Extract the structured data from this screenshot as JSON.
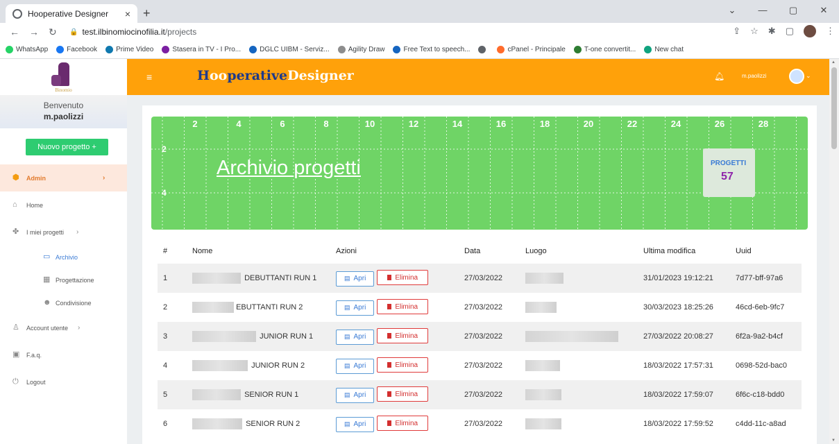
{
  "browser": {
    "tab_title": "Hooperative Designer",
    "tab_close": "×",
    "new_tab": "+",
    "url_domain": "test.ilbinomiocinofilia.it",
    "url_path": "/projects",
    "bookmarks": [
      {
        "label": "WhatsApp",
        "color": "#25d366"
      },
      {
        "label": "Facebook",
        "color": "#1877f2"
      },
      {
        "label": "Prime Video",
        "color": "#0f79af"
      },
      {
        "label": "Stasera in TV - I Pro...",
        "color": "#7b1fa2"
      },
      {
        "label": "DGLC UIBM - Serviz...",
        "color": "#1565c0"
      },
      {
        "label": "Agility Draw",
        "color": "#8d8d8d"
      },
      {
        "label": "Free Text to speech...",
        "color": "#1565c0"
      },
      {
        "label": "",
        "color": "#5f6368"
      },
      {
        "label": "cPanel - Principale",
        "color": "#ff6c2c"
      },
      {
        "label": "T-one convertit...",
        "color": "#2e7d32"
      },
      {
        "label": "New chat",
        "color": "#10a37f"
      }
    ]
  },
  "sidebar": {
    "welcome": "Benvenuto",
    "username": "m.paolizzi",
    "logo_text": "Binomio",
    "new_project": "Nuovo progetto +",
    "menu": {
      "admin": "Admin",
      "home": "Home",
      "my_projects": "I miei progetti",
      "archivio": "Archivio",
      "progettazione": "Progettazione",
      "condivisione": "Condivisione",
      "account": "Account utente",
      "faq": "F.a.q.",
      "logout": "Logout"
    }
  },
  "header": {
    "brand_h": "H",
    "brand_oo": "oo",
    "brand_rest": "perative",
    "brand_designer": "Designer",
    "user": "m.paolizzi"
  },
  "field": {
    "title": "Archivio progetti",
    "x_ticks": [
      "2",
      "4",
      "6",
      "8",
      "10",
      "12",
      "14",
      "16",
      "18",
      "20",
      "22",
      "24",
      "26",
      "28"
    ],
    "y_ticks": [
      "2",
      "4"
    ],
    "badge_label": "PROGETTI",
    "badge_value": "57"
  },
  "table": {
    "headers": [
      "#",
      "Nome",
      "Azioni",
      "Data",
      "Luogo",
      "Ultima modifica",
      "Uuid"
    ],
    "open_label": "Apri",
    "delete_label": "Elimina",
    "rows": [
      {
        "n": "1",
        "name": "DEBUTTANTI RUN 1",
        "date": "27/03/2022",
        "modified": "31/01/2023 19:12:21",
        "uuid": "7d77-bff-97a6"
      },
      {
        "n": "2",
        "name": "EBUTTANTI RUN 2",
        "date": "27/03/2022",
        "modified": "30/03/2023 18:25:26",
        "uuid": "46cd-6eb-9fc7"
      },
      {
        "n": "3",
        "name": "JUNIOR RUN 1",
        "date": "27/03/2022",
        "modified": "27/03/2022 20:08:27",
        "uuid": "6f2a-9a2-b4cf"
      },
      {
        "n": "4",
        "name": "JUNIOR RUN 2",
        "date": "27/03/2022",
        "modified": "18/03/2022 17:57:31",
        "uuid": "0698-52d-bac0"
      },
      {
        "n": "5",
        "name": "SENIOR RUN 1",
        "date": "27/03/2022",
        "modified": "18/03/2022 17:59:07",
        "uuid": "6f6c-c18-bdd0"
      },
      {
        "n": "6",
        "name": "SENIOR RUN 2",
        "date": "27/03/2022",
        "modified": "18/03/2022 17:59:52",
        "uuid": "c4dd-11c-a8ad"
      }
    ]
  }
}
